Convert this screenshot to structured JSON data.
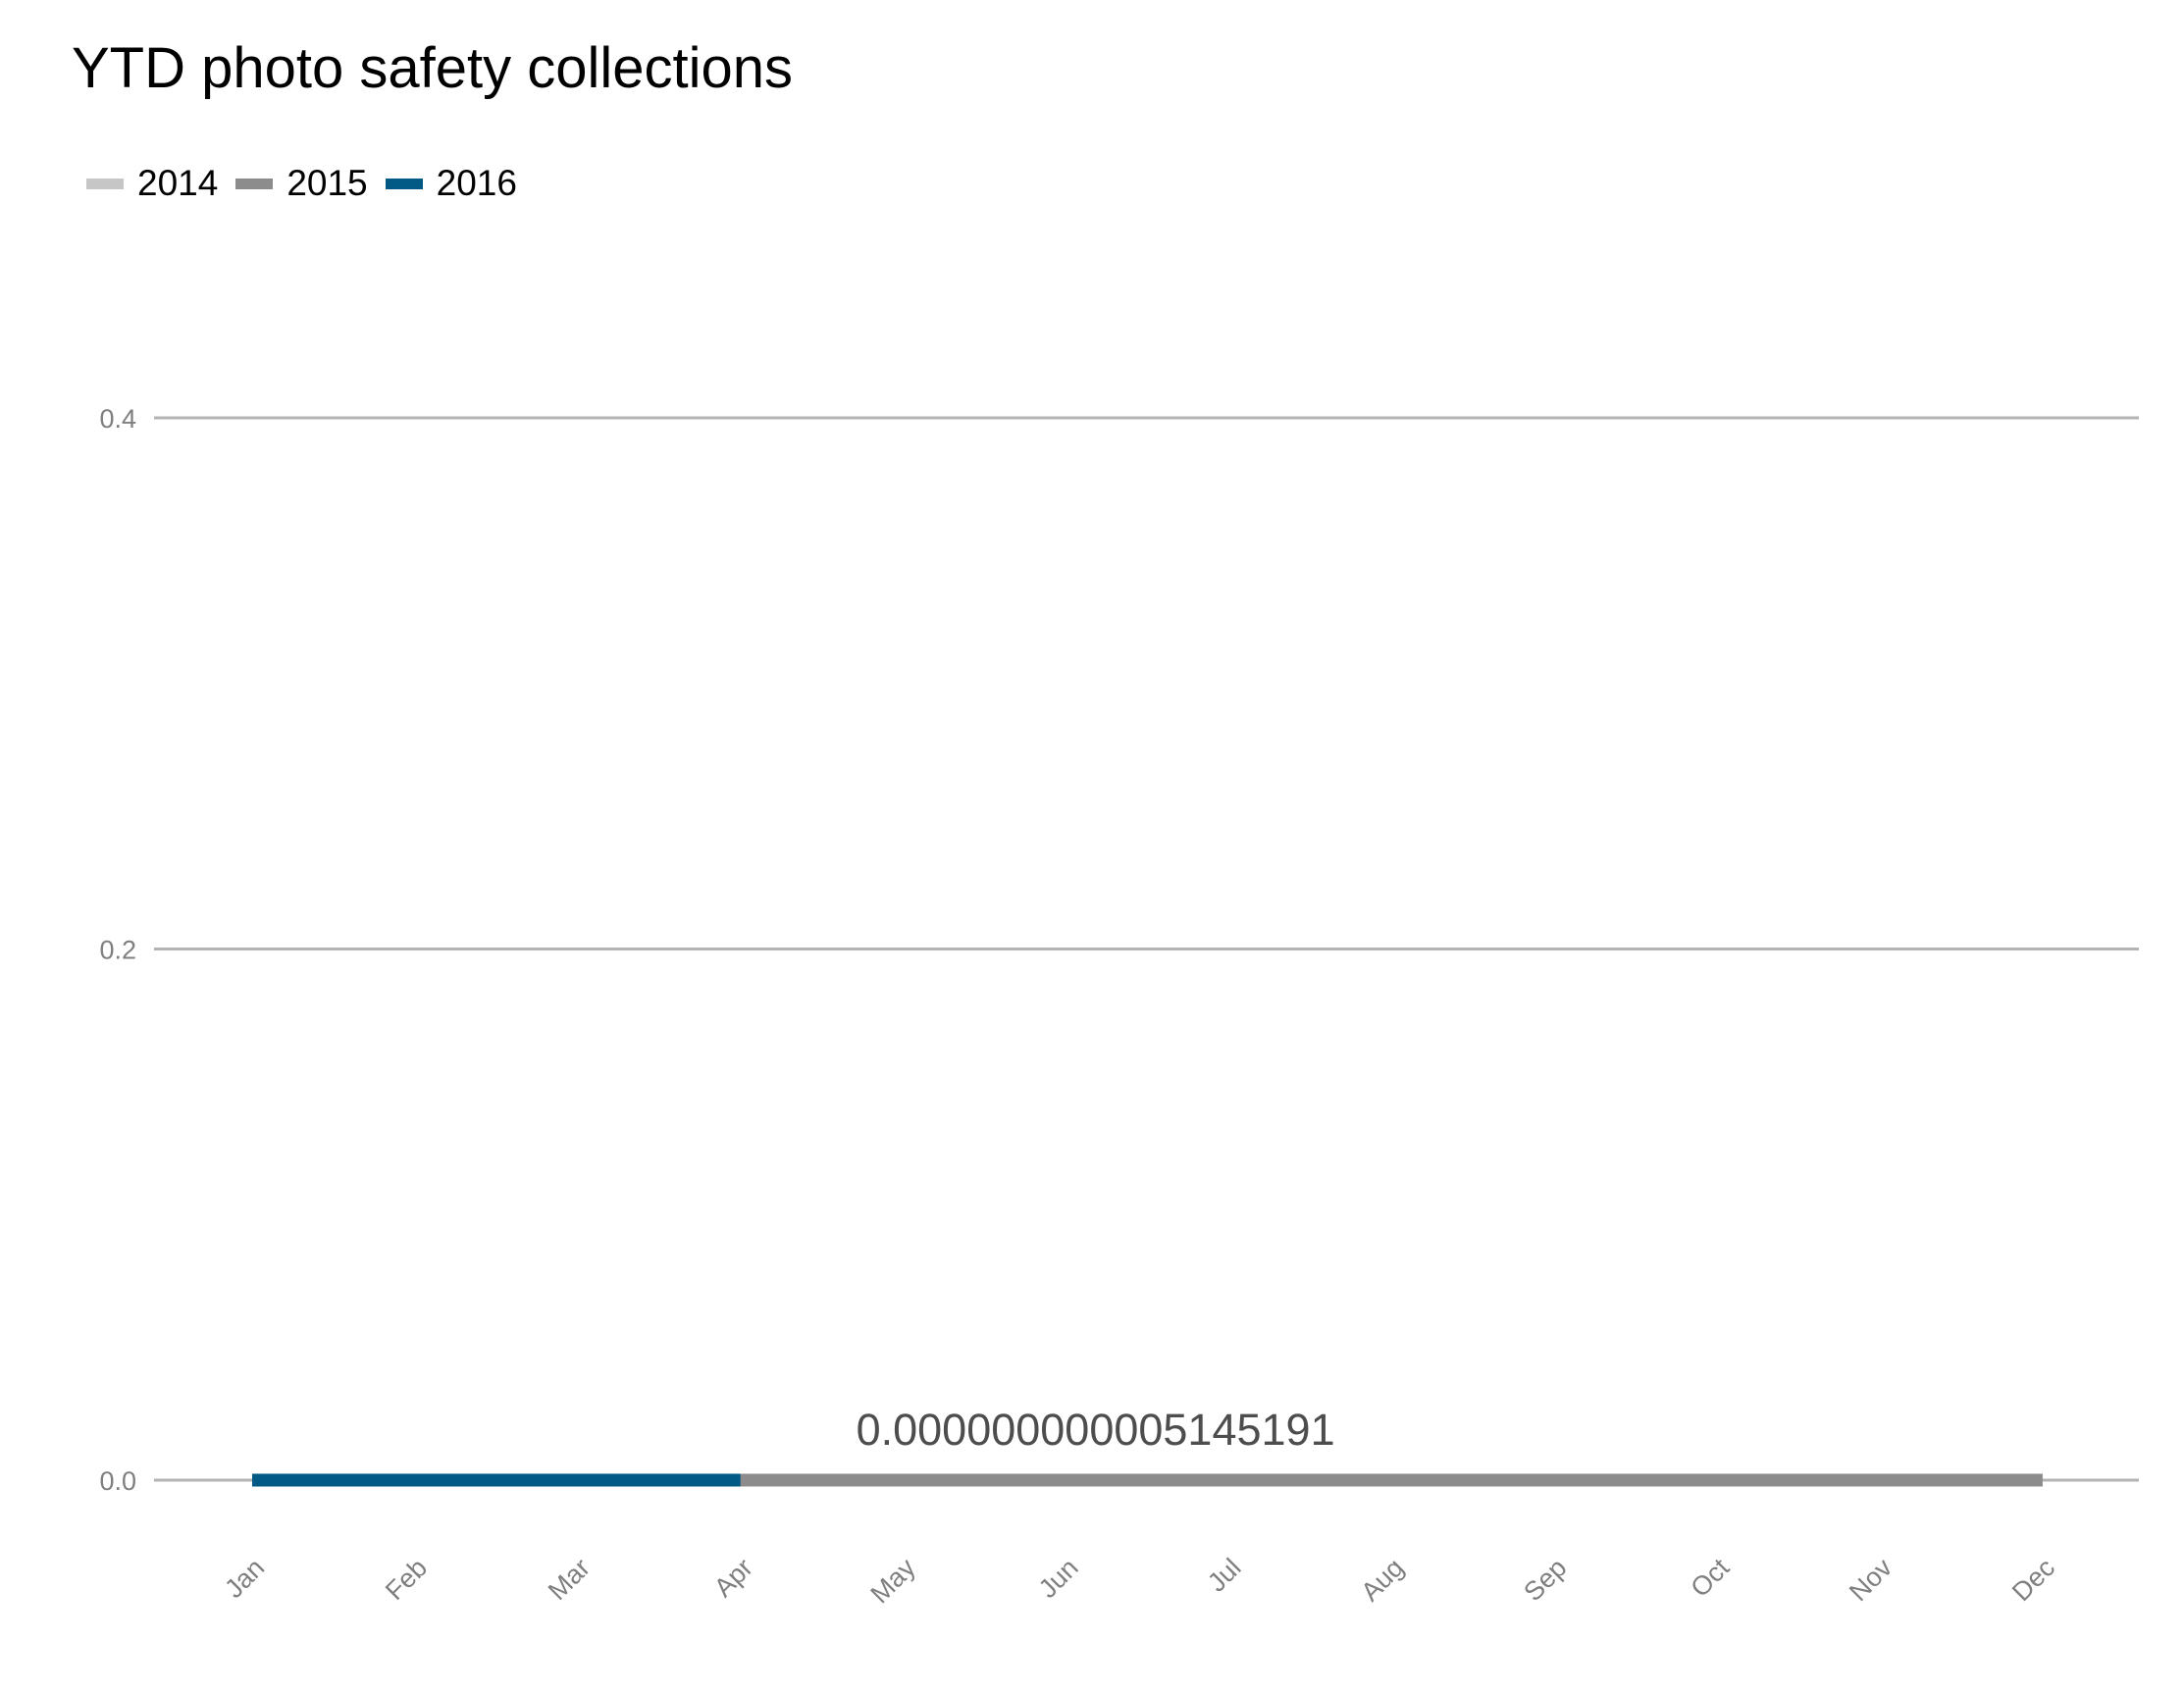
{
  "chart_data": {
    "type": "line",
    "title": "YTD photo safety collections",
    "xlabel": "",
    "ylabel": "",
    "categories": [
      "Jan",
      "Feb",
      "Mar",
      "Apr",
      "May",
      "Jun",
      "Jul",
      "Aug",
      "Sep",
      "Oct",
      "Nov",
      "Dec"
    ],
    "y_ticks": [
      "0.0",
      "0.2",
      "0.4"
    ],
    "ylim": [
      0,
      0.4
    ],
    "grid": "horizontal",
    "legend_position": "top-left",
    "series": [
      {
        "name": "2014",
        "color": "#c6c6c6",
        "values": [
          0,
          0,
          0,
          0,
          0,
          0,
          0,
          0,
          0,
          0,
          0,
          0
        ]
      },
      {
        "name": "2015",
        "color": "#8c8c8c",
        "values": [
          0,
          0,
          0,
          0,
          0,
          0,
          0,
          0,
          0,
          0,
          0,
          0
        ]
      },
      {
        "name": "2016",
        "color": "#005a85",
        "values": [
          0,
          0,
          0,
          0,
          null,
          null,
          null,
          null,
          null,
          null,
          null,
          null
        ]
      }
    ],
    "annotations": [
      {
        "text": "0.000000000005145191",
        "x": "May",
        "y": 5.145191e-12
      }
    ]
  }
}
